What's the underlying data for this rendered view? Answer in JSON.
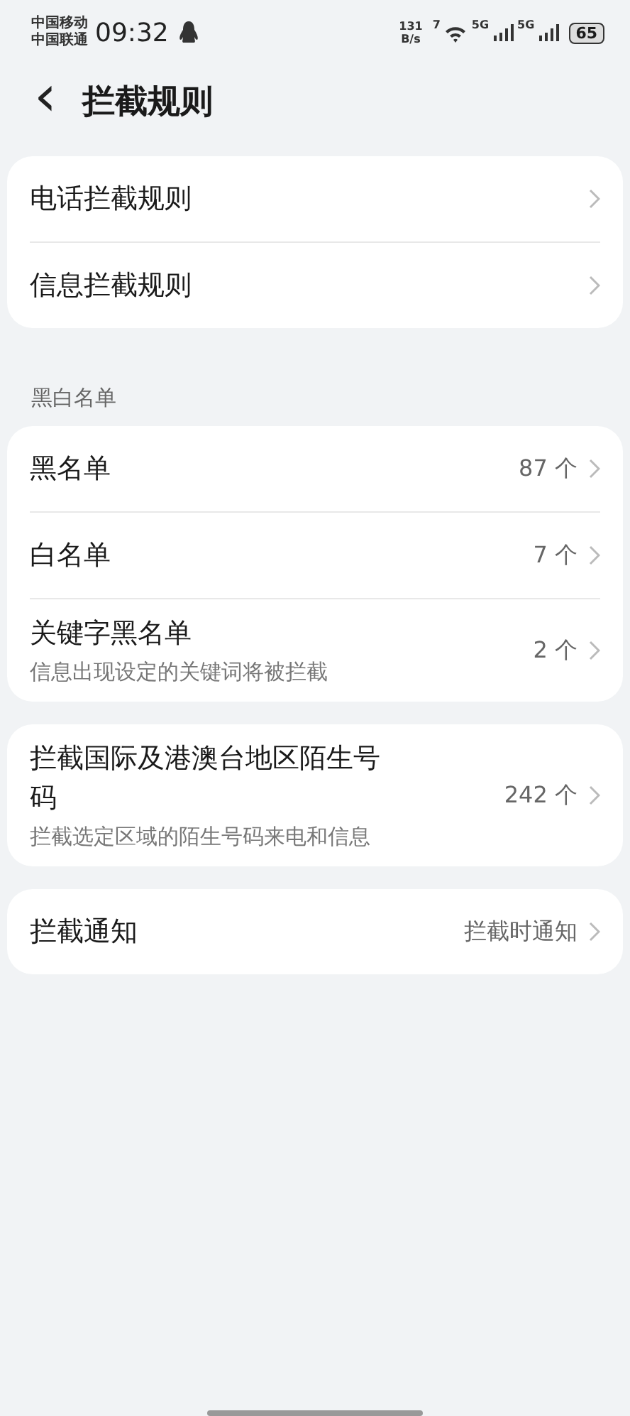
{
  "status_bar": {
    "carriers": [
      "中国移动",
      "中国联通"
    ],
    "time": "09:32",
    "net_speed": [
      "131",
      "B/s"
    ],
    "wifi_label": "7",
    "signals": [
      {
        "label": "5G"
      },
      {
        "label": "5G"
      }
    ],
    "battery": "65"
  },
  "header": {
    "back": "‹",
    "title": "拦截规则"
  },
  "groups": [
    {
      "items": [
        {
          "title": "电话拦截规则"
        },
        {
          "title": "信息拦截规则"
        }
      ]
    },
    {
      "heading": "黑白名单",
      "items": [
        {
          "title": "黑名单",
          "value": "87 个"
        },
        {
          "title": "白名单",
          "value": "7 个"
        },
        {
          "title": "关键字黑名单",
          "subtitle": "信息出现设定的关键词将被拦截",
          "value": "2 个"
        }
      ]
    },
    {
      "items": [
        {
          "title": "拦截国际及港澳台地区陌生号码",
          "subtitle": "拦截选定区域的陌生号码来电和信息",
          "value": "242 个"
        }
      ]
    },
    {
      "items": [
        {
          "title": "拦截通知",
          "value": "拦截时通知"
        }
      ]
    }
  ]
}
